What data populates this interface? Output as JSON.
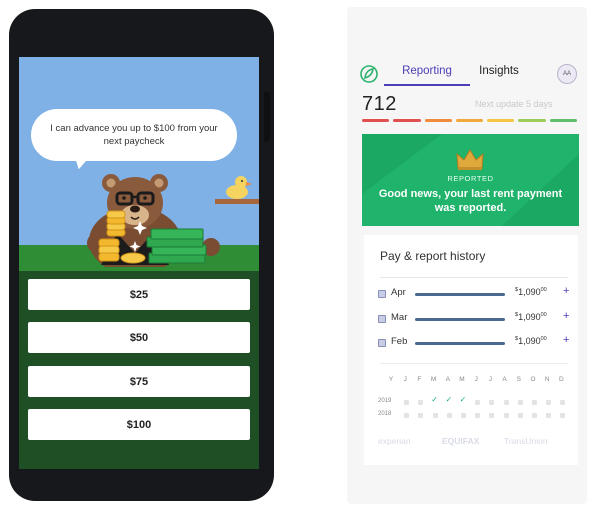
{
  "left_screen": {
    "bubble_text": "I can advance you up to $100 from your next paycheck",
    "answers": [
      "$25",
      "$50",
      "$75",
      "$100"
    ],
    "colors": {
      "sky": "#7fb0e6",
      "grass": "#2f8d36",
      "ground": "#1e4f25"
    }
  },
  "right_screen": {
    "tabs": {
      "reporting": "Reporting",
      "insights": "Insights"
    },
    "avatar_initials": "AA",
    "score": "712",
    "next_update": "Next update 5 days",
    "score_bar_colors": [
      "#e0504f",
      "#e0504f",
      "#f08a3c",
      "#f2a93b",
      "#f4c542",
      "#9ccc5a",
      "#5fbf6a"
    ],
    "banner": {
      "label": "REPORTED",
      "message": "Good news, your last rent payment was reported.",
      "color": "#1fb36b"
    },
    "history": {
      "title": "Pay & report history",
      "rows": [
        {
          "month": "Apr",
          "amount_sup": "$",
          "amount": "1,090",
          "amount_cents": "00"
        },
        {
          "month": "Mar",
          "amount_sup": "$",
          "amount": "1,090",
          "amount_cents": "00"
        },
        {
          "month": "Feb",
          "amount_sup": "$",
          "amount": "1,090",
          "amount_cents": "00"
        }
      ],
      "plus": "+",
      "month_letters": [
        "Y",
        "J",
        "F",
        "M",
        "A",
        "M",
        "J",
        "J",
        "A",
        "S",
        "O",
        "N",
        "D"
      ],
      "years": [
        "2019",
        "2018"
      ],
      "bureaus": [
        "experian",
        "EQUIFAX",
        "TransUnion"
      ]
    }
  }
}
